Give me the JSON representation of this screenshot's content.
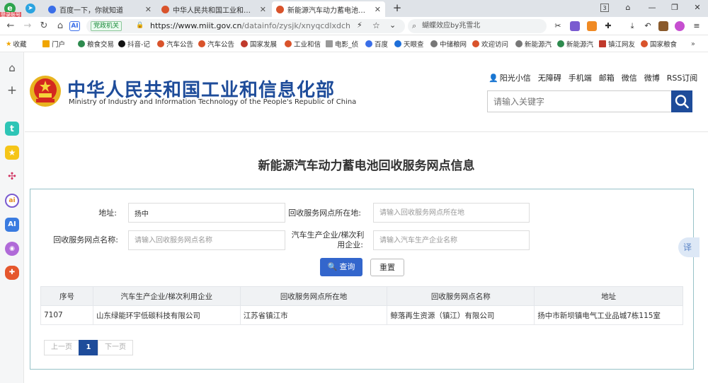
{
  "browser": {
    "tabs": [
      {
        "label": "百度一下，你就知道",
        "active": false,
        "color": "#3a6ee8"
      },
      {
        "label": "中华人民共和国工业和信息化部",
        "active": false,
        "color": "#d9532b"
      },
      {
        "label": "新能源汽车动力蓄电池回收服",
        "active": true,
        "color": "#d9532b"
      }
    ],
    "new_tab": "+",
    "tab_count": "3",
    "user_badge": "登录账号",
    "gov_badge": "党政机关",
    "url_main": "https://www.miit.gov.cn",
    "url_path": "/datainfo/zysjk/xnyqcdlxdch",
    "search_query": "蝴蝶效应by兆雪北",
    "bookmarks": [
      "收藏",
      "门户",
      "粮食交易",
      "抖音-记",
      "汽车公告",
      "汽车公告",
      "国家发展",
      "工业和信",
      "电影_侦",
      "百度",
      "天眼查",
      "中储粮网",
      "欢迎访问",
      "新能源汽",
      "新能源汽",
      "镇江网友",
      "国家粮食"
    ],
    "translate_label": "译"
  },
  "site": {
    "title_cn": "中华人民共和国工业和信息化部",
    "title_en": "Ministry of Industry and Information Technology of the People's Republic of China",
    "top_links": [
      "阳光小信",
      "无障碍",
      "手机端",
      "邮箱",
      "微信",
      "微博",
      "RSS订阅"
    ],
    "search_placeholder": "请输入关键字"
  },
  "page": {
    "title": "新能源汽车动力蓄电池回收服务网点信息"
  },
  "form": {
    "address_label": "地址:",
    "address_value": "扬中",
    "location_label": "回收服务网点所在地:",
    "location_placeholder": "请输入回收服务网点所在地",
    "name_label": "回收服务网点名称:",
    "name_placeholder": "请输入回收服务网点名称",
    "company_label_line1": "汽车生产企业/梯次利",
    "company_label_line2": "用企业:",
    "company_placeholder": "请输入汽车生产企业名称",
    "query_button": "查询",
    "reset_button": "重置"
  },
  "table": {
    "headers": [
      "序号",
      "汽车生产企业/梯次利用企业",
      "回收服务网点所在地",
      "回收服务网点名称",
      "地址"
    ],
    "rows": [
      [
        "7107",
        "山东绿能环宇低碳科技有限公司",
        "江苏省镇江市",
        "鲸落再生资源（镇江）有限公司",
        "扬中市新坝镇电气工业品城7栋115室"
      ]
    ]
  },
  "pager": {
    "prev": "上一页",
    "current": "1",
    "next": "下一页"
  },
  "colors": {
    "brand_blue": "#1e4c9a",
    "query_blue": "#3366cc",
    "panel_border": "#97c2c8"
  }
}
